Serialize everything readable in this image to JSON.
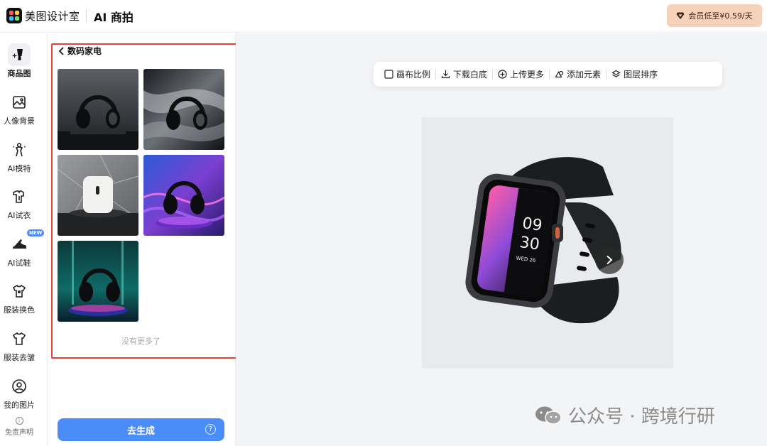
{
  "header": {
    "brand": "美图设计室",
    "product": "AI 商拍",
    "vip_label": "会员低至¥0.59/天"
  },
  "nav": {
    "items": [
      {
        "label": "商品图",
        "icon": "product-image-icon",
        "active": true
      },
      {
        "label": "人像背景",
        "icon": "portrait-background-icon"
      },
      {
        "label": "AI模特",
        "icon": "ai-model-icon"
      },
      {
        "label": "AI试衣",
        "icon": "ai-try-on-clothes-icon"
      },
      {
        "label": "AI试鞋",
        "icon": "ai-try-on-shoes-icon",
        "badge": "NEW"
      },
      {
        "label": "服装换色",
        "icon": "clothing-recolor-icon"
      },
      {
        "label": "服装去皱",
        "icon": "clothing-dewrinkle-icon"
      },
      {
        "label": "我的图片",
        "icon": "my-images-icon"
      }
    ],
    "disclaimer": "免责声明"
  },
  "gallery": {
    "back_label": "数码家电",
    "thumbnails": [
      {
        "subject": "headphones",
        "scene": "dark-podium"
      },
      {
        "subject": "headphones",
        "scene": "black-silk"
      },
      {
        "subject": "speaker",
        "scene": "marble"
      },
      {
        "subject": "headphones",
        "scene": "neon-purple"
      },
      {
        "subject": "headphones",
        "scene": "teal-glow"
      }
    ],
    "end_text": "没有更多了",
    "generate_label": "去生成",
    "help_symbol": "?"
  },
  "toolbar": {
    "items": [
      {
        "label": "画布比例",
        "icon": "canvas-ratio-icon"
      },
      {
        "label": "下载白底",
        "icon": "download-icon"
      },
      {
        "label": "上传更多",
        "icon": "upload-plus-icon"
      },
      {
        "label": "添加元素",
        "icon": "add-element-icon"
      },
      {
        "label": "图层排序",
        "icon": "layers-icon"
      }
    ]
  },
  "preview": {
    "watch_time_hour": "09",
    "watch_time_min": "30",
    "watch_date": "WED 26"
  },
  "watermark": {
    "text": "公众号 · 跨境行研"
  },
  "colors": {
    "accent": "#4a8df8",
    "highlight": "#e8413a",
    "vip_bg": "#f6d2bb"
  }
}
